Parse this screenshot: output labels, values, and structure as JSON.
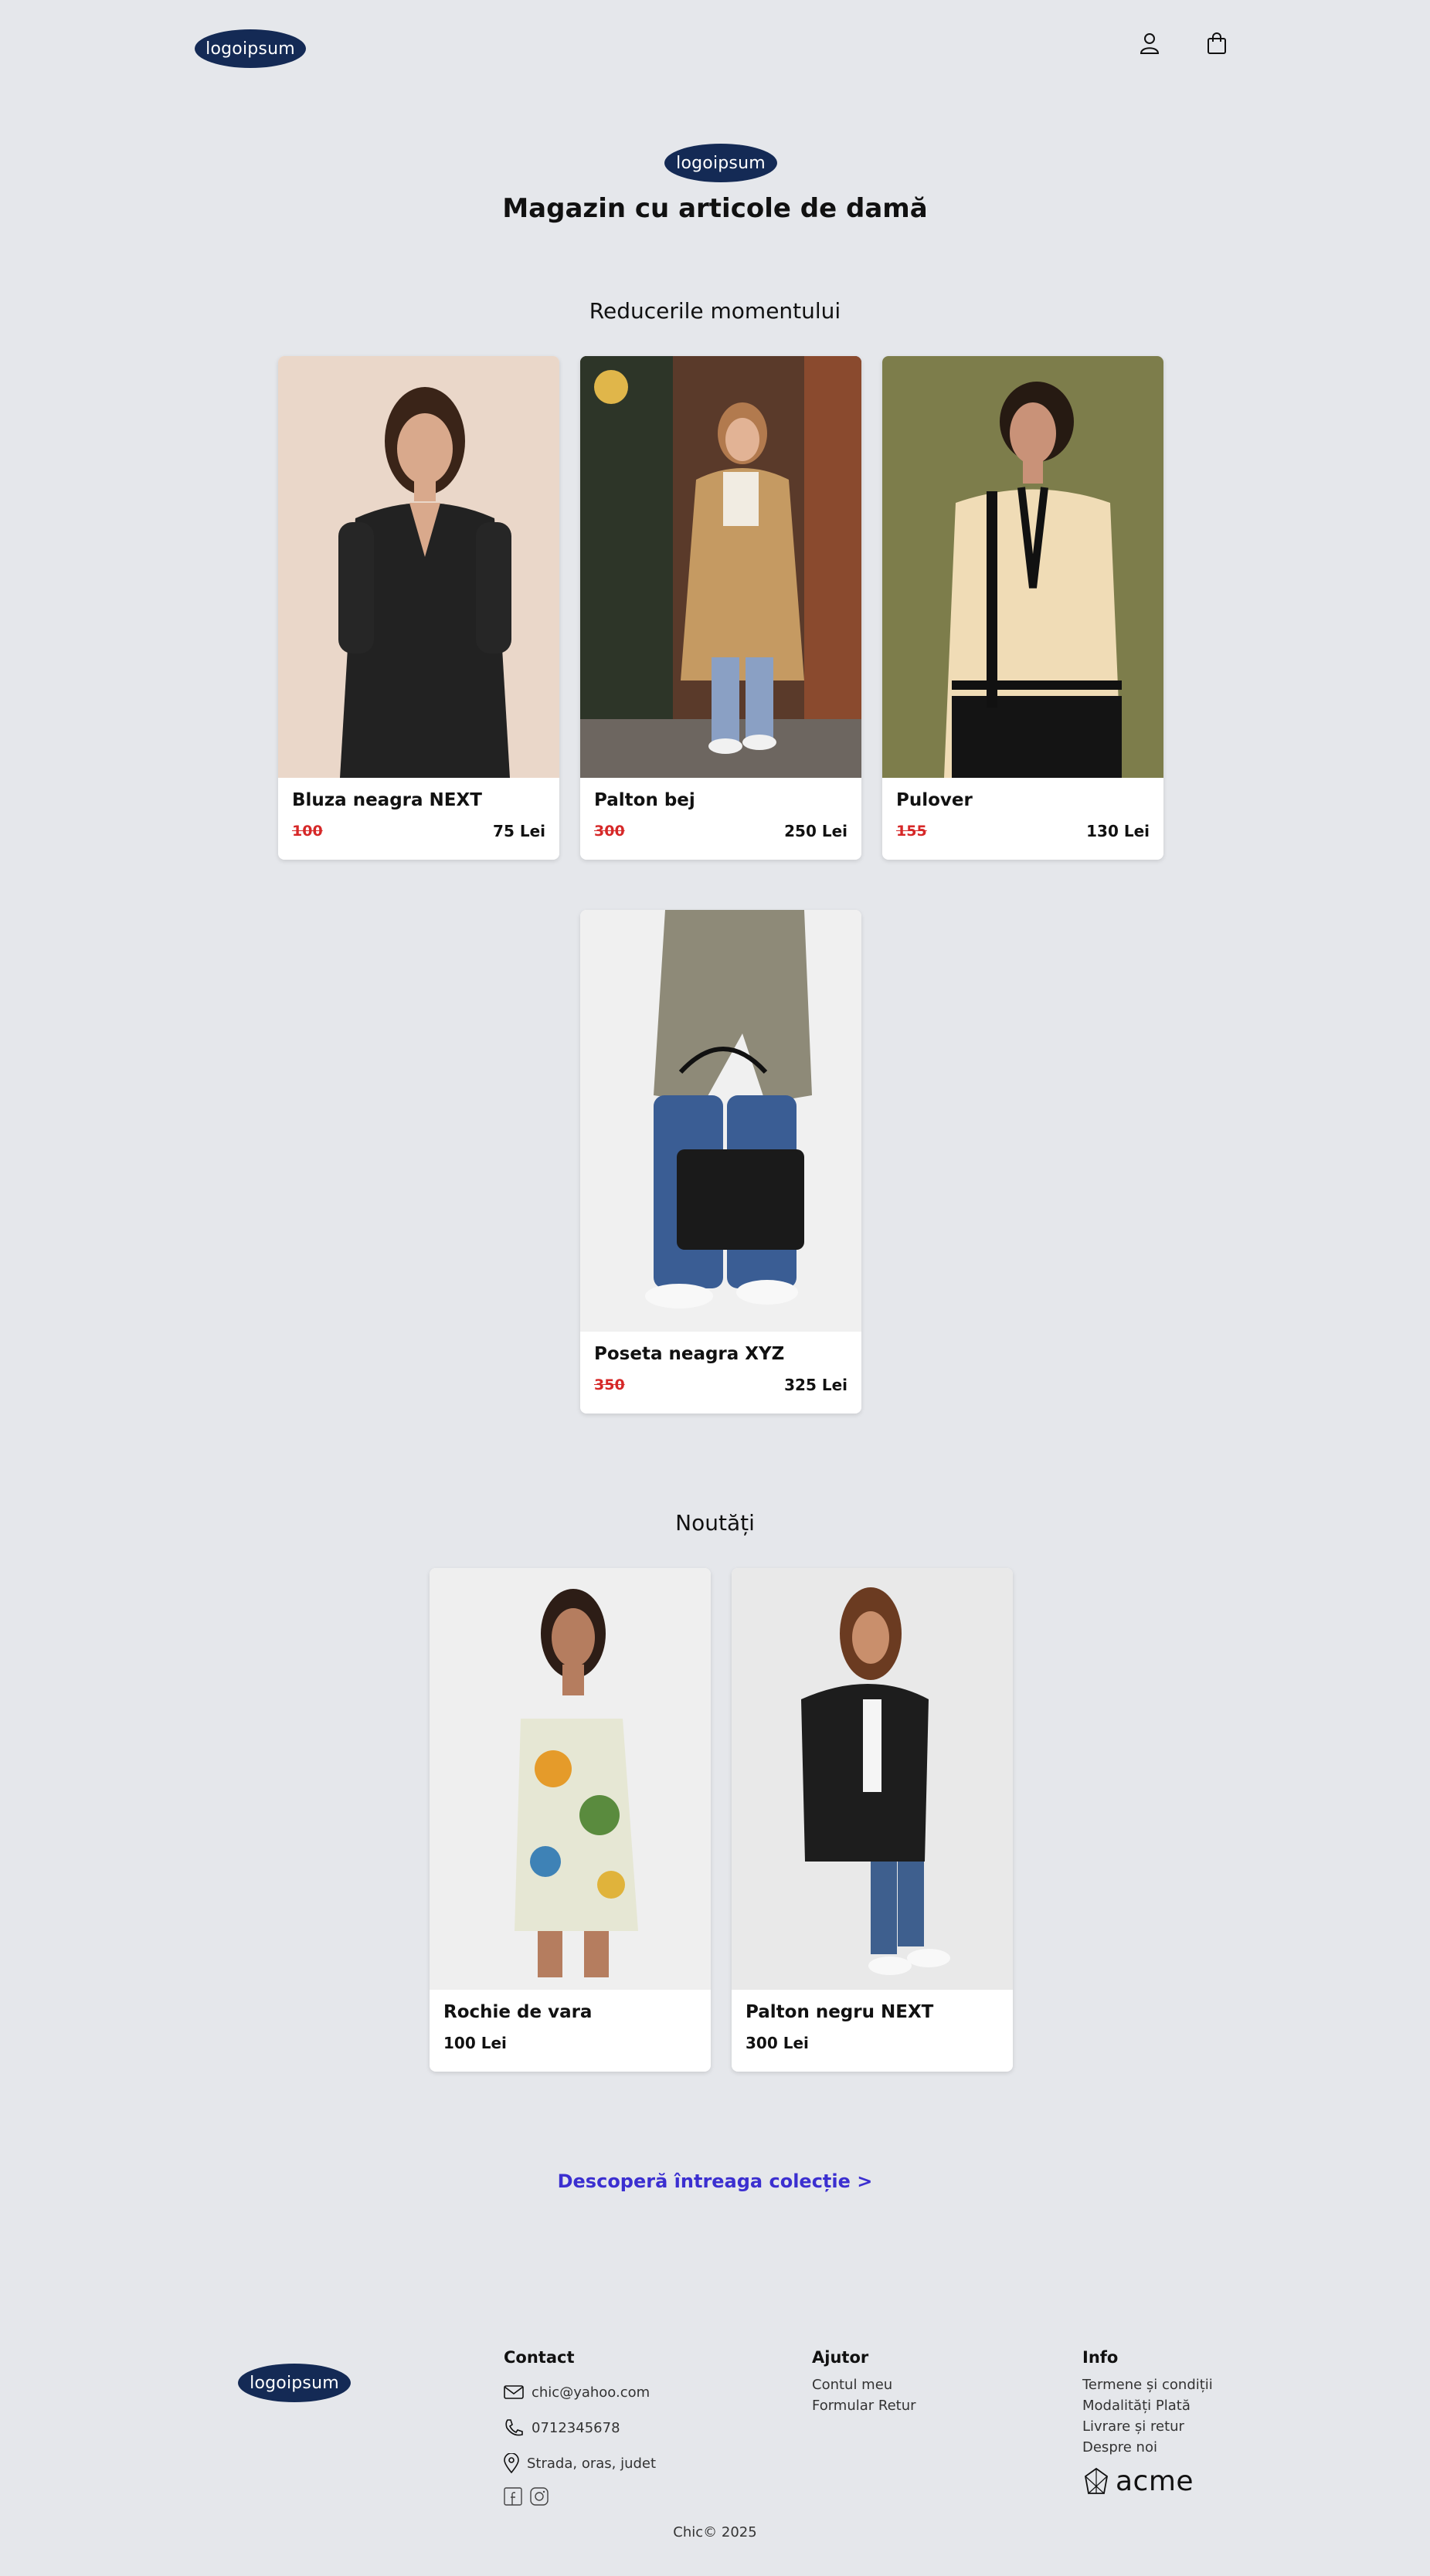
{
  "header": {
    "logo_text": "logoipsum",
    "user_icon": "user-icon",
    "bag_icon": "shopping-bag-icon"
  },
  "hero": {
    "logo_text": "logoipsum",
    "title": "Magazin cu articole de damă"
  },
  "sale": {
    "title": "Reducerile momentului",
    "products": [
      {
        "name": "Bluza neagra NEXT",
        "old_price": "100",
        "new_price": "75 Lei"
      },
      {
        "name": "Palton bej",
        "old_price": "300",
        "new_price": "250 Lei"
      },
      {
        "name": "Pulover",
        "old_price": "155",
        "new_price": "130 Lei"
      },
      {
        "name": "Poseta neagra XYZ",
        "old_price": "350",
        "new_price": "325 Lei"
      }
    ]
  },
  "new_arrivals": {
    "title": "Noutăți",
    "products": [
      {
        "name": "Rochie de vara",
        "price": "100 Lei"
      },
      {
        "name": "Palton negru NEXT",
        "price": "300 Lei"
      }
    ]
  },
  "discover_link": "Descoperă întreaga colecție >",
  "footer": {
    "logo_text": "logoipsum",
    "contact": {
      "heading": "Contact",
      "email": "chic@yahoo.com",
      "phone": "0712345678",
      "address": "Strada, oras, judet"
    },
    "help": {
      "heading": "Ajutor",
      "links": [
        "Contul meu",
        "Formular Retur"
      ]
    },
    "info": {
      "heading": "Info",
      "links": [
        "Termene și condiții",
        "Modalități Plată",
        "Livrare și retur",
        "Despre noi"
      ]
    },
    "acme_text": "acme",
    "copyright": "Chic© 2025"
  },
  "colors": {
    "background": "#e5e7eb",
    "logo_bg": "#142a55",
    "old_price": "#d62828",
    "link": "#3b2fd0"
  }
}
